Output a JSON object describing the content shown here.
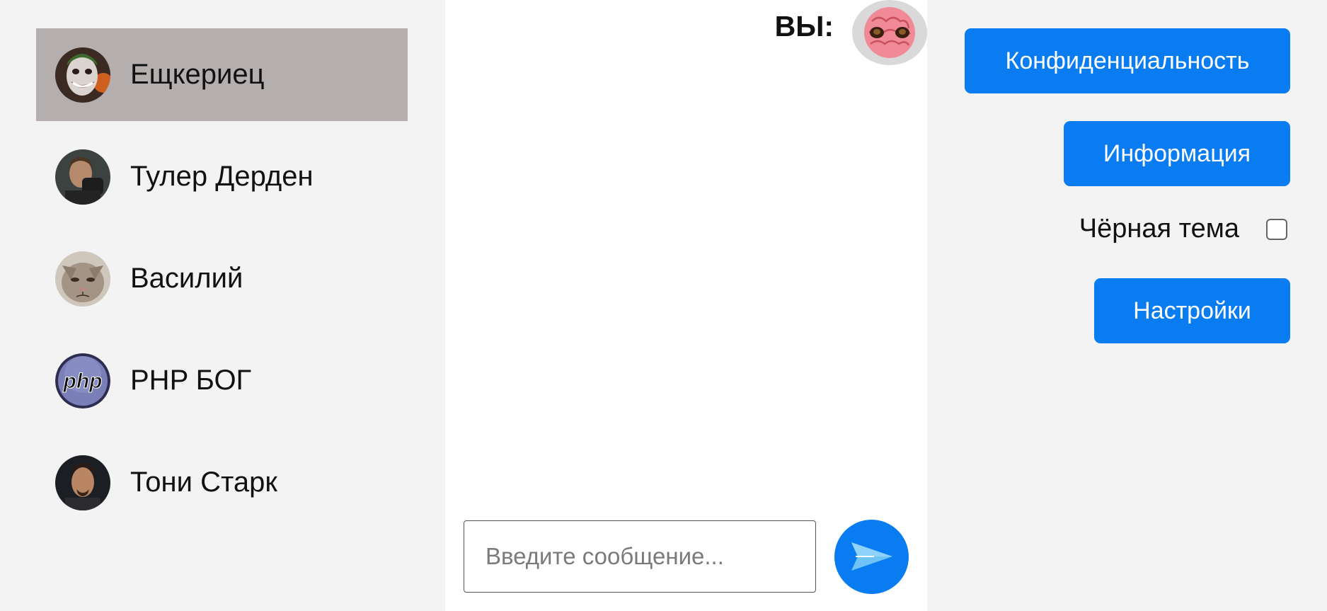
{
  "contacts": [
    {
      "name": "Ещкериец",
      "avatar": "joker-avatar",
      "active": true
    },
    {
      "name": "Тулер Дерден",
      "avatar": "tyler-avatar",
      "active": false
    },
    {
      "name": "Василий",
      "avatar": "cat-avatar",
      "active": false
    },
    {
      "name": "PHP БОГ",
      "avatar": "php-logo-avatar",
      "active": false
    },
    {
      "name": "Тони Старк",
      "avatar": "tony-avatar",
      "active": false
    }
  ],
  "chat": {
    "me_label": "ВЫ:",
    "me_avatar": "pink-brain-avatar",
    "input_placeholder": "Введите сообщение...",
    "input_value": "",
    "send_icon": "send-arrow-icon"
  },
  "settings": {
    "privacy_label": "Конфиденциальность",
    "info_label": "Информация",
    "dark_theme_label": "Чёрная тема",
    "dark_theme_checked": false,
    "settings_label": "Настройки"
  },
  "colors": {
    "accent": "#0a7cf2",
    "active_contact_bg": "#b5aeae",
    "panel_bg": "#f3f3f3",
    "chat_bg": "#ffffff"
  }
}
